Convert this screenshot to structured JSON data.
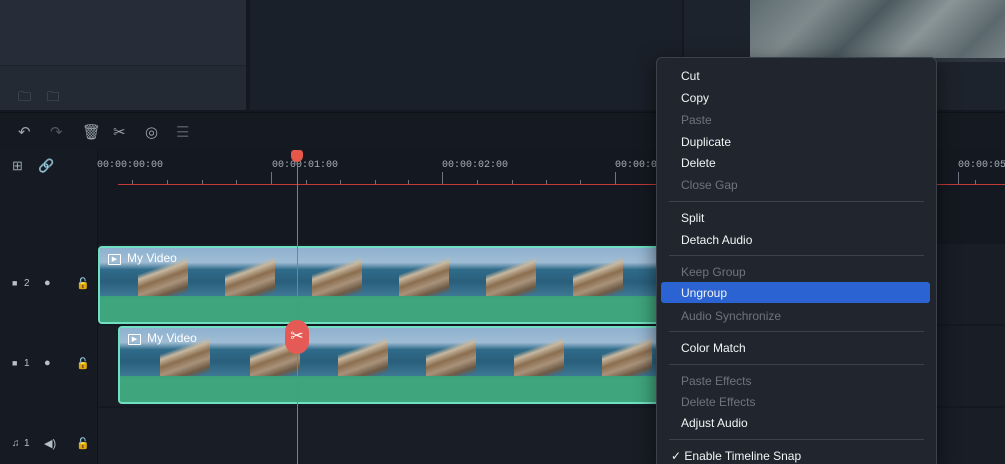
{
  "toolbar": {
    "icons": [
      "undo-icon",
      "redo-icon",
      "trash-icon",
      "scissors-icon",
      "palette-icon",
      "adjust-icon"
    ]
  },
  "ruler": {
    "labels": [
      "00:00:00:00",
      "00:00:01:00",
      "00:00:02:00",
      "00:00:0:",
      "00:00:05:"
    ]
  },
  "tracks": [
    {
      "number": "2",
      "clip_title": "My Video"
    },
    {
      "number": "1",
      "clip_title": "My Video"
    },
    {
      "number": "1"
    }
  ],
  "context_menu": {
    "items": [
      {
        "label": "Cut",
        "enabled": true
      },
      {
        "label": "Copy",
        "enabled": true
      },
      {
        "label": "Paste",
        "enabled": false
      },
      {
        "label": "Duplicate",
        "enabled": true
      },
      {
        "label": "Delete",
        "enabled": true
      },
      {
        "label": "Close Gap",
        "enabled": false
      },
      {
        "label": "Split",
        "enabled": true
      },
      {
        "label": "Detach Audio",
        "enabled": true
      },
      {
        "label": "Keep Group",
        "enabled": false
      },
      {
        "label": "Ungroup",
        "enabled": true,
        "selected": true
      },
      {
        "label": "Audio Synchronize",
        "enabled": false
      },
      {
        "label": "Color Match",
        "enabled": true
      },
      {
        "label": "Paste Effects",
        "enabled": false
      },
      {
        "label": "Delete Effects",
        "enabled": false
      },
      {
        "label": "Adjust Audio",
        "enabled": true
      },
      {
        "label": "✓ Enable Timeline Snap",
        "enabled": true
      }
    ]
  },
  "colors": {
    "accent_selected": "#2b64d2",
    "clip_border": "#6fe0c2",
    "playhead": "#e05a4a"
  }
}
